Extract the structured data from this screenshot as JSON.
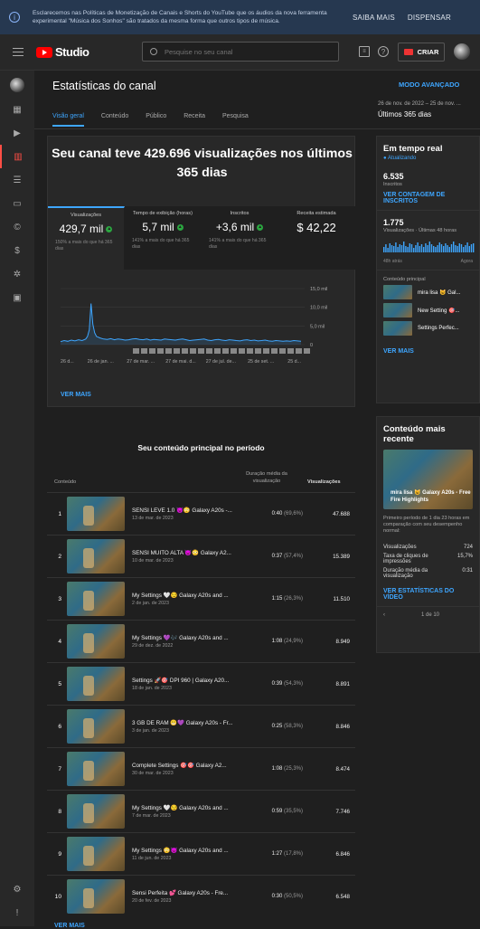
{
  "banner": {
    "text": "Esclarecemos nas Políticas de Monetização de Canais e Shorts do YouTube que os áudios da nova ferramenta experimental \"Música dos Sonhos\" são tratados da mesma forma que outros tipos de música.",
    "learn_more": "SAIBA MAIS",
    "dismiss": "DISPENSAR"
  },
  "header": {
    "logo_text": "Studio",
    "search_placeholder": "Pesquise no seu canal",
    "create_label": "CRIAR"
  },
  "page": {
    "title": "Estatísticas do canal",
    "advanced_mode": "MODO AVANÇADO",
    "date_range": "26 de nov. de 2022 – 25 de nov. ...",
    "date_selected": "Últimos 365 dias",
    "tabs": [
      "Visão geral",
      "Conteúdo",
      "Público",
      "Receita",
      "Pesquisa"
    ]
  },
  "overview": {
    "headline": "Seu canal teve 429.696 visualizações nos últimos 365 dias",
    "metrics": [
      {
        "label": "Visualizações",
        "value": "429,7 mil",
        "compare": "150% a mais do que há 365 dias"
      },
      {
        "label": "Tempo de exibição (horas)",
        "value": "5,7 mil",
        "compare": "141% a mais do que há 365 dias"
      },
      {
        "label": "Inscritos",
        "value": "+3,6 mil",
        "compare": "141% a mais do que há 365 dias"
      },
      {
        "label": "Receita estimada",
        "value": "$ 42,22",
        "compare": ""
      }
    ],
    "see_more": "VER MAIS"
  },
  "chart_data": {
    "type": "line",
    "yticks": [
      "15,0 mil",
      "10,0 mil",
      "5,0 mil",
      "0"
    ],
    "ylim": [
      0,
      15000
    ],
    "xticks": [
      "26 d...",
      "26 de jan. ...",
      "27 de mar. ...",
      "27 de mai. d...",
      "27 de jul. de...",
      "25 de set. ...",
      "25 d..."
    ],
    "x": [
      0,
      4,
      8,
      12,
      16,
      20,
      24,
      28,
      30,
      32,
      34,
      36,
      38,
      40,
      44,
      48,
      52,
      56,
      60,
      64,
      68,
      72,
      76,
      80,
      84,
      88,
      92,
      96,
      100,
      104,
      108,
      112,
      116,
      120,
      124,
      128,
      132,
      136,
      140,
      144,
      148,
      152,
      156,
      160,
      164,
      168,
      172,
      176,
      180,
      184,
      188,
      192,
      196,
      200,
      204,
      208,
      212,
      216,
      220,
      224,
      228,
      232,
      236,
      240,
      244,
      248,
      252,
      256,
      260,
      264,
      268
    ],
    "values": [
      800,
      1100,
      900,
      1200,
      1000,
      1300,
      1100,
      1500,
      2200,
      4000,
      11000,
      5500,
      3200,
      2200,
      1800,
      1500,
      1400,
      1600,
      1300,
      1500,
      1400,
      1200,
      1300,
      1500,
      1600,
      1400,
      1300,
      1500,
      1200,
      1400,
      1300,
      1200,
      1500,
      1400,
      1300,
      1200,
      1400,
      1500,
      1300,
      1100,
      1200,
      1300,
      1400,
      1500,
      1200,
      1100,
      1300,
      1400,
      1200,
      1100,
      1300,
      1200,
      1100,
      1000,
      1200,
      1300,
      1100,
      1200,
      1000,
      1100,
      1200,
      1000,
      900,
      1100,
      1000,
      900,
      1000,
      900,
      1100,
      1000,
      900
    ]
  },
  "top_content": {
    "title": "Seu conteúdo principal no período",
    "col_content": "Conteúdo",
    "col_duration": "Duração média da visualização",
    "col_views": "Visualizações",
    "rows": [
      {
        "rank": "1",
        "title": "SENSI LEVE 1.0 😈😳 Galaxy A20s -...",
        "date": "13 de mar. de 2023",
        "dur": "0:40",
        "pct": "(69,6%)",
        "views": "47.688"
      },
      {
        "rank": "2",
        "title": "SENSI MUITO ALTA 😈😳 Galaxy A2...",
        "date": "10 de mar. de 2023",
        "dur": "0:37",
        "pct": "(57,4%)",
        "views": "15.389"
      },
      {
        "rank": "3",
        "title": "My Settings 🤍😏 Galaxy A20s and ...",
        "date": "2 de jan. de 2023",
        "dur": "1:15",
        "pct": "(26,3%)",
        "views": "11.510"
      },
      {
        "rank": "4",
        "title": "My Settings 💜🎶 Galaxy A20s and ...",
        "date": "29 de dez. de 2022",
        "dur": "1:08",
        "pct": "(24,9%)",
        "views": "8.949"
      },
      {
        "rank": "5",
        "title": "Settings 🚀🎯 DPI 960 | Galaxy A20...",
        "date": "18 de jan. de 2023",
        "dur": "0:39",
        "pct": "(54,3%)",
        "views": "8.891"
      },
      {
        "rank": "6",
        "title": "3 GB DE RAM 😬💜 Galaxy A20s - Fr...",
        "date": "3 de jan. de 2023",
        "dur": "0:25",
        "pct": "(58,3%)",
        "views": "8.846"
      },
      {
        "rank": "7",
        "title": "Complete Settings 🎯🎯 Galaxy A2...",
        "date": "30 de mar. de 2023",
        "dur": "1:08",
        "pct": "(25,3%)",
        "views": "8.474"
      },
      {
        "rank": "8",
        "title": "My Settings 🤍😏 Galaxy A20s and ...",
        "date": "7 de mar. de 2023",
        "dur": "0:59",
        "pct": "(35,5%)",
        "views": "7.746"
      },
      {
        "rank": "9",
        "title": "My Settings 😳😈 Galaxy A20s and ...",
        "date": "11 de jun. de 2023",
        "dur": "1:27",
        "pct": "(17,8%)",
        "views": "6.846"
      },
      {
        "rank": "10",
        "title": "Sensi Perfeita 💕 Galaxy A20s - Fre...",
        "date": "20 de fev. de 2023",
        "dur": "0:30",
        "pct": "(50,5%)",
        "views": "6.548"
      }
    ],
    "see_more": "VER MAIS"
  },
  "realtime": {
    "title": "Em tempo real",
    "status": "Atualizando",
    "subscribers": "6.535",
    "subscribers_label": "Inscritos",
    "subs_link": "VER CONTAGEM DE INSCRITOS",
    "views": "1.775",
    "views_label": "Visualizações · Últimas 48 horas",
    "time_label": "48h atrás",
    "now_label": "Agora",
    "top_label": "Conteúdo principal",
    "items": [
      "mira lisa 😺 Gal...",
      "New Setting 🎯...",
      "Settings Perfec..."
    ],
    "see_more": "VER MAIS"
  },
  "latest": {
    "title": "Conteúdo mais recente",
    "video_title": "mira lisa 😺 Galaxy A20s - Free Fire Highlights",
    "desc": "Primeiro período de 1 dia 23 horas em comparação com seu desempenho normal:",
    "stats": [
      {
        "label": "Visualizações",
        "value": "724"
      },
      {
        "label": "Taxa de cliques de impressões",
        "value": "15,7%"
      },
      {
        "label": "Duração média da visualização",
        "value": "0:31"
      }
    ],
    "link": "VER ESTATÍSTICAS DO VÍDEO",
    "pager": "1 de 10"
  }
}
